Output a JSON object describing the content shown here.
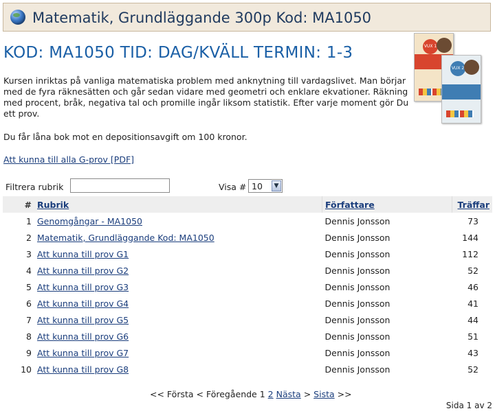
{
  "title": "Matematik, Grundläggande 300p Kod: MA1050",
  "heading": "KOD: MA1050 TID: DAG/KVÄLL TERMIN: 1-3",
  "intro": "Kursen inriktas på vanliga matematiska problem med anknytning till vardagslivet. Man börjar med de fyra räknesätten och går sedan vidare med geometri och enklare ekvationer. Räkning med procent, bråk, negativa tal och promille ingår liksom statistik. Efter varje moment gör Du ett prov.",
  "loan_text": "Du får låna bok mot en depositionsavgift om 100 kronor.",
  "pdf_link": "Att kunna till alla G-prov [PDF]",
  "books": {
    "book1_label": "VUX 1",
    "book2_label": "VUX 2"
  },
  "filter": {
    "label": "Filtrera rubrik",
    "value": "",
    "visa_label": "Visa #",
    "visa_value": "10"
  },
  "table": {
    "headers": {
      "num": "#",
      "rubrik": "Rubrik",
      "author": "Författare",
      "hits": "Träffar"
    },
    "rows": [
      {
        "num": "1",
        "rubrik": "Genomgångar - MA1050",
        "author": "Dennis Jonsson",
        "hits": "73"
      },
      {
        "num": "2",
        "rubrik": "Matematik, Grundläggande Kod: MA1050",
        "author": "Dennis Jonsson",
        "hits": "144"
      },
      {
        "num": "3",
        "rubrik": "Att kunna till prov G1",
        "author": "Dennis Jonsson",
        "hits": "112"
      },
      {
        "num": "4",
        "rubrik": "Att kunna till prov G2",
        "author": "Dennis Jonsson",
        "hits": "52"
      },
      {
        "num": "5",
        "rubrik": "Att kunna till prov G3",
        "author": "Dennis Jonsson",
        "hits": "46"
      },
      {
        "num": "6",
        "rubrik": "Att kunna till prov G4",
        "author": "Dennis Jonsson",
        "hits": "41"
      },
      {
        "num": "7",
        "rubrik": "Att kunna till prov G5",
        "author": "Dennis Jonsson",
        "hits": "44"
      },
      {
        "num": "8",
        "rubrik": "Att kunna till prov G6",
        "author": "Dennis Jonsson",
        "hits": "51"
      },
      {
        "num": "9",
        "rubrik": "Att kunna till prov G7",
        "author": "Dennis Jonsson",
        "hits": "43"
      },
      {
        "num": "10",
        "rubrik": "Att kunna till prov G8",
        "author": "Dennis Jonsson",
        "hits": "52"
      }
    ]
  },
  "pager": {
    "first": "<< Första",
    "prev": "< Föregående",
    "page1": "1",
    "page2": "2",
    "next": "Nästa",
    "next_arrow": ">",
    "last": "Sista",
    "last_arrow": ">>",
    "info": "Sida 1 av 2"
  },
  "colors": {
    "heading": "#1a5fa6",
    "titlebar_bg": "#f1e9dc",
    "link": "#1a3d7c"
  }
}
